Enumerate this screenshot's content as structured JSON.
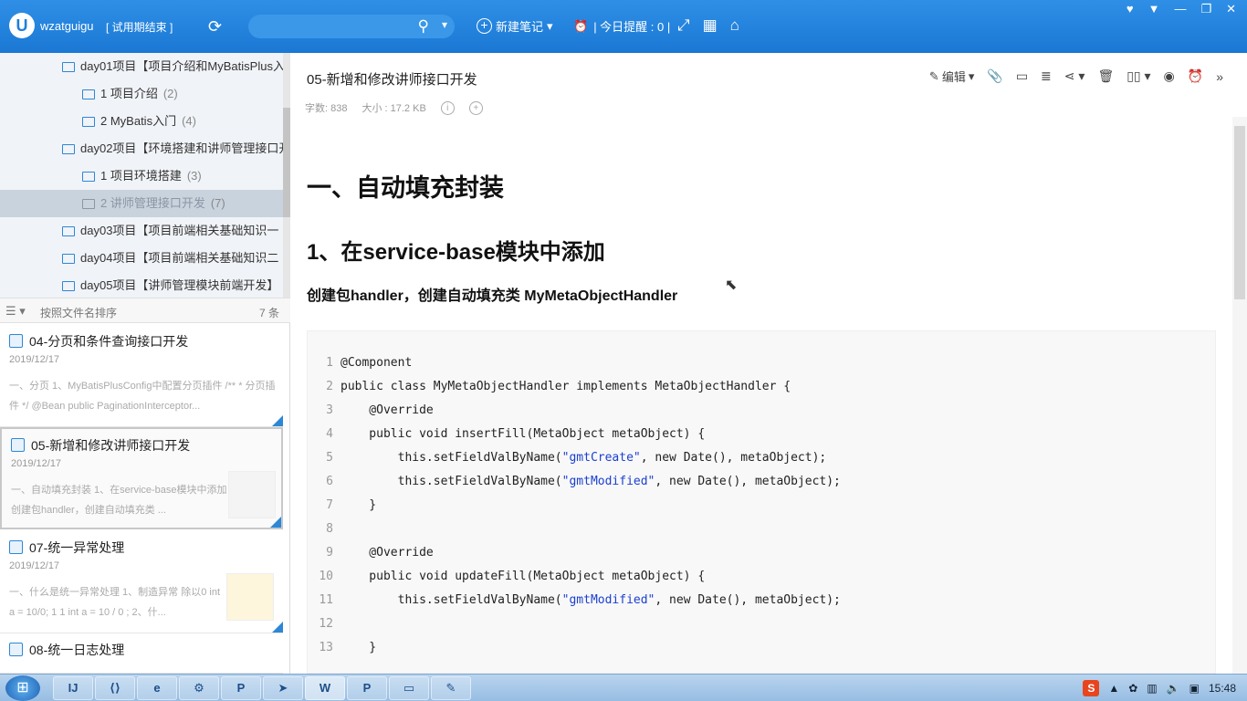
{
  "topbar": {
    "logo": "U",
    "username": "wzatguigu",
    "trial": "[ 试用期结束 ]",
    "new_note": "新建笔记",
    "reminder": "| 今日提醒 : 0 |"
  },
  "tree": [
    {
      "label": "day01项目【项目介绍和MyBatisPlus入",
      "count": ""
    },
    {
      "label": "1 项目介绍",
      "count": "(2)"
    },
    {
      "label": "2 MyBatis入门",
      "count": "(4)"
    },
    {
      "label": "day02项目【环境搭建和讲师管理接口开",
      "count": ""
    },
    {
      "label": "1 项目环境搭建",
      "count": "(3)"
    },
    {
      "label": "2 讲师管理接口开发",
      "count": "(7)"
    },
    {
      "label": "day03项目【项目前端相关基础知识一",
      "count": ""
    },
    {
      "label": "day04项目【项目前端相关基础知识二",
      "count": ""
    },
    {
      "label": "day05项目【讲师管理模块前端开发】",
      "count": ""
    }
  ],
  "sort": {
    "label": "按照文件名排序",
    "count": "7 条"
  },
  "notes": [
    {
      "title": "04-分页和条件查询接口开发",
      "date": "2019/12/17",
      "snippet": "一、分页 1、MyBatisPlusConfig中配置分页插件 /** * 分页插件 */ @Bean public PaginationInterceptor..."
    },
    {
      "title": "05-新增和修改讲师接口开发",
      "date": "2019/12/17",
      "snippet": "一、自动填充封装 1、在service-base模块中添加 创建包handler，创建自动填充类 ..."
    },
    {
      "title": "07-统一异常处理",
      "date": "2019/12/17",
      "snippet": "一、什么是统一异常处理 1、制造异常 除以0 int a = 10/0; 1 1 int a = 10 / 0 ; 2、什..."
    },
    {
      "title": "08-统一日志处理",
      "date": "",
      "snippet": ""
    }
  ],
  "doc": {
    "title": "05-新增和修改讲师接口开发",
    "word_count": "字数: 838",
    "size": "大小 : 17.2 KB",
    "edit_label": "编辑",
    "h1": "一、自动填充封装",
    "h2": "1、在service-base模块中添加",
    "h3": "创建包handler，创建自动填充类 MyMetaObjectHandler"
  },
  "code_lines": [
    {
      "n": "1",
      "pre": "@Component",
      "str": "",
      "post": ""
    },
    {
      "n": "2",
      "pre": "public class MyMetaObjectHandler implements MetaObjectHandler {",
      "str": "",
      "post": ""
    },
    {
      "n": "3",
      "pre": "    @Override",
      "str": "",
      "post": ""
    },
    {
      "n": "4",
      "pre": "    public void insertFill(MetaObject metaObject) {",
      "str": "",
      "post": ""
    },
    {
      "n": "5",
      "pre": "        this.setFieldValByName(",
      "str": "\"gmtCreate\"",
      "post": ", new Date(), metaObject);"
    },
    {
      "n": "6",
      "pre": "        this.setFieldValByName(",
      "str": "\"gmtModified\"",
      "post": ", new Date(), metaObject);"
    },
    {
      "n": "7",
      "pre": "    }",
      "str": "",
      "post": ""
    },
    {
      "n": "8",
      "pre": "",
      "str": "",
      "post": ""
    },
    {
      "n": "9",
      "pre": "    @Override",
      "str": "",
      "post": ""
    },
    {
      "n": "10",
      "pre": "    public void updateFill(MetaObject metaObject) {",
      "str": "",
      "post": ""
    },
    {
      "n": "11",
      "pre": "        this.setFieldValByName(",
      "str": "\"gmtModified\"",
      "post": ", new Date(), metaObject);"
    },
    {
      "n": "12",
      "pre": "",
      "str": "",
      "post": ""
    },
    {
      "n": "13",
      "pre": "    }",
      "str": "",
      "post": ""
    }
  ],
  "taskbar": {
    "ime": "S",
    "time": "15:48"
  }
}
